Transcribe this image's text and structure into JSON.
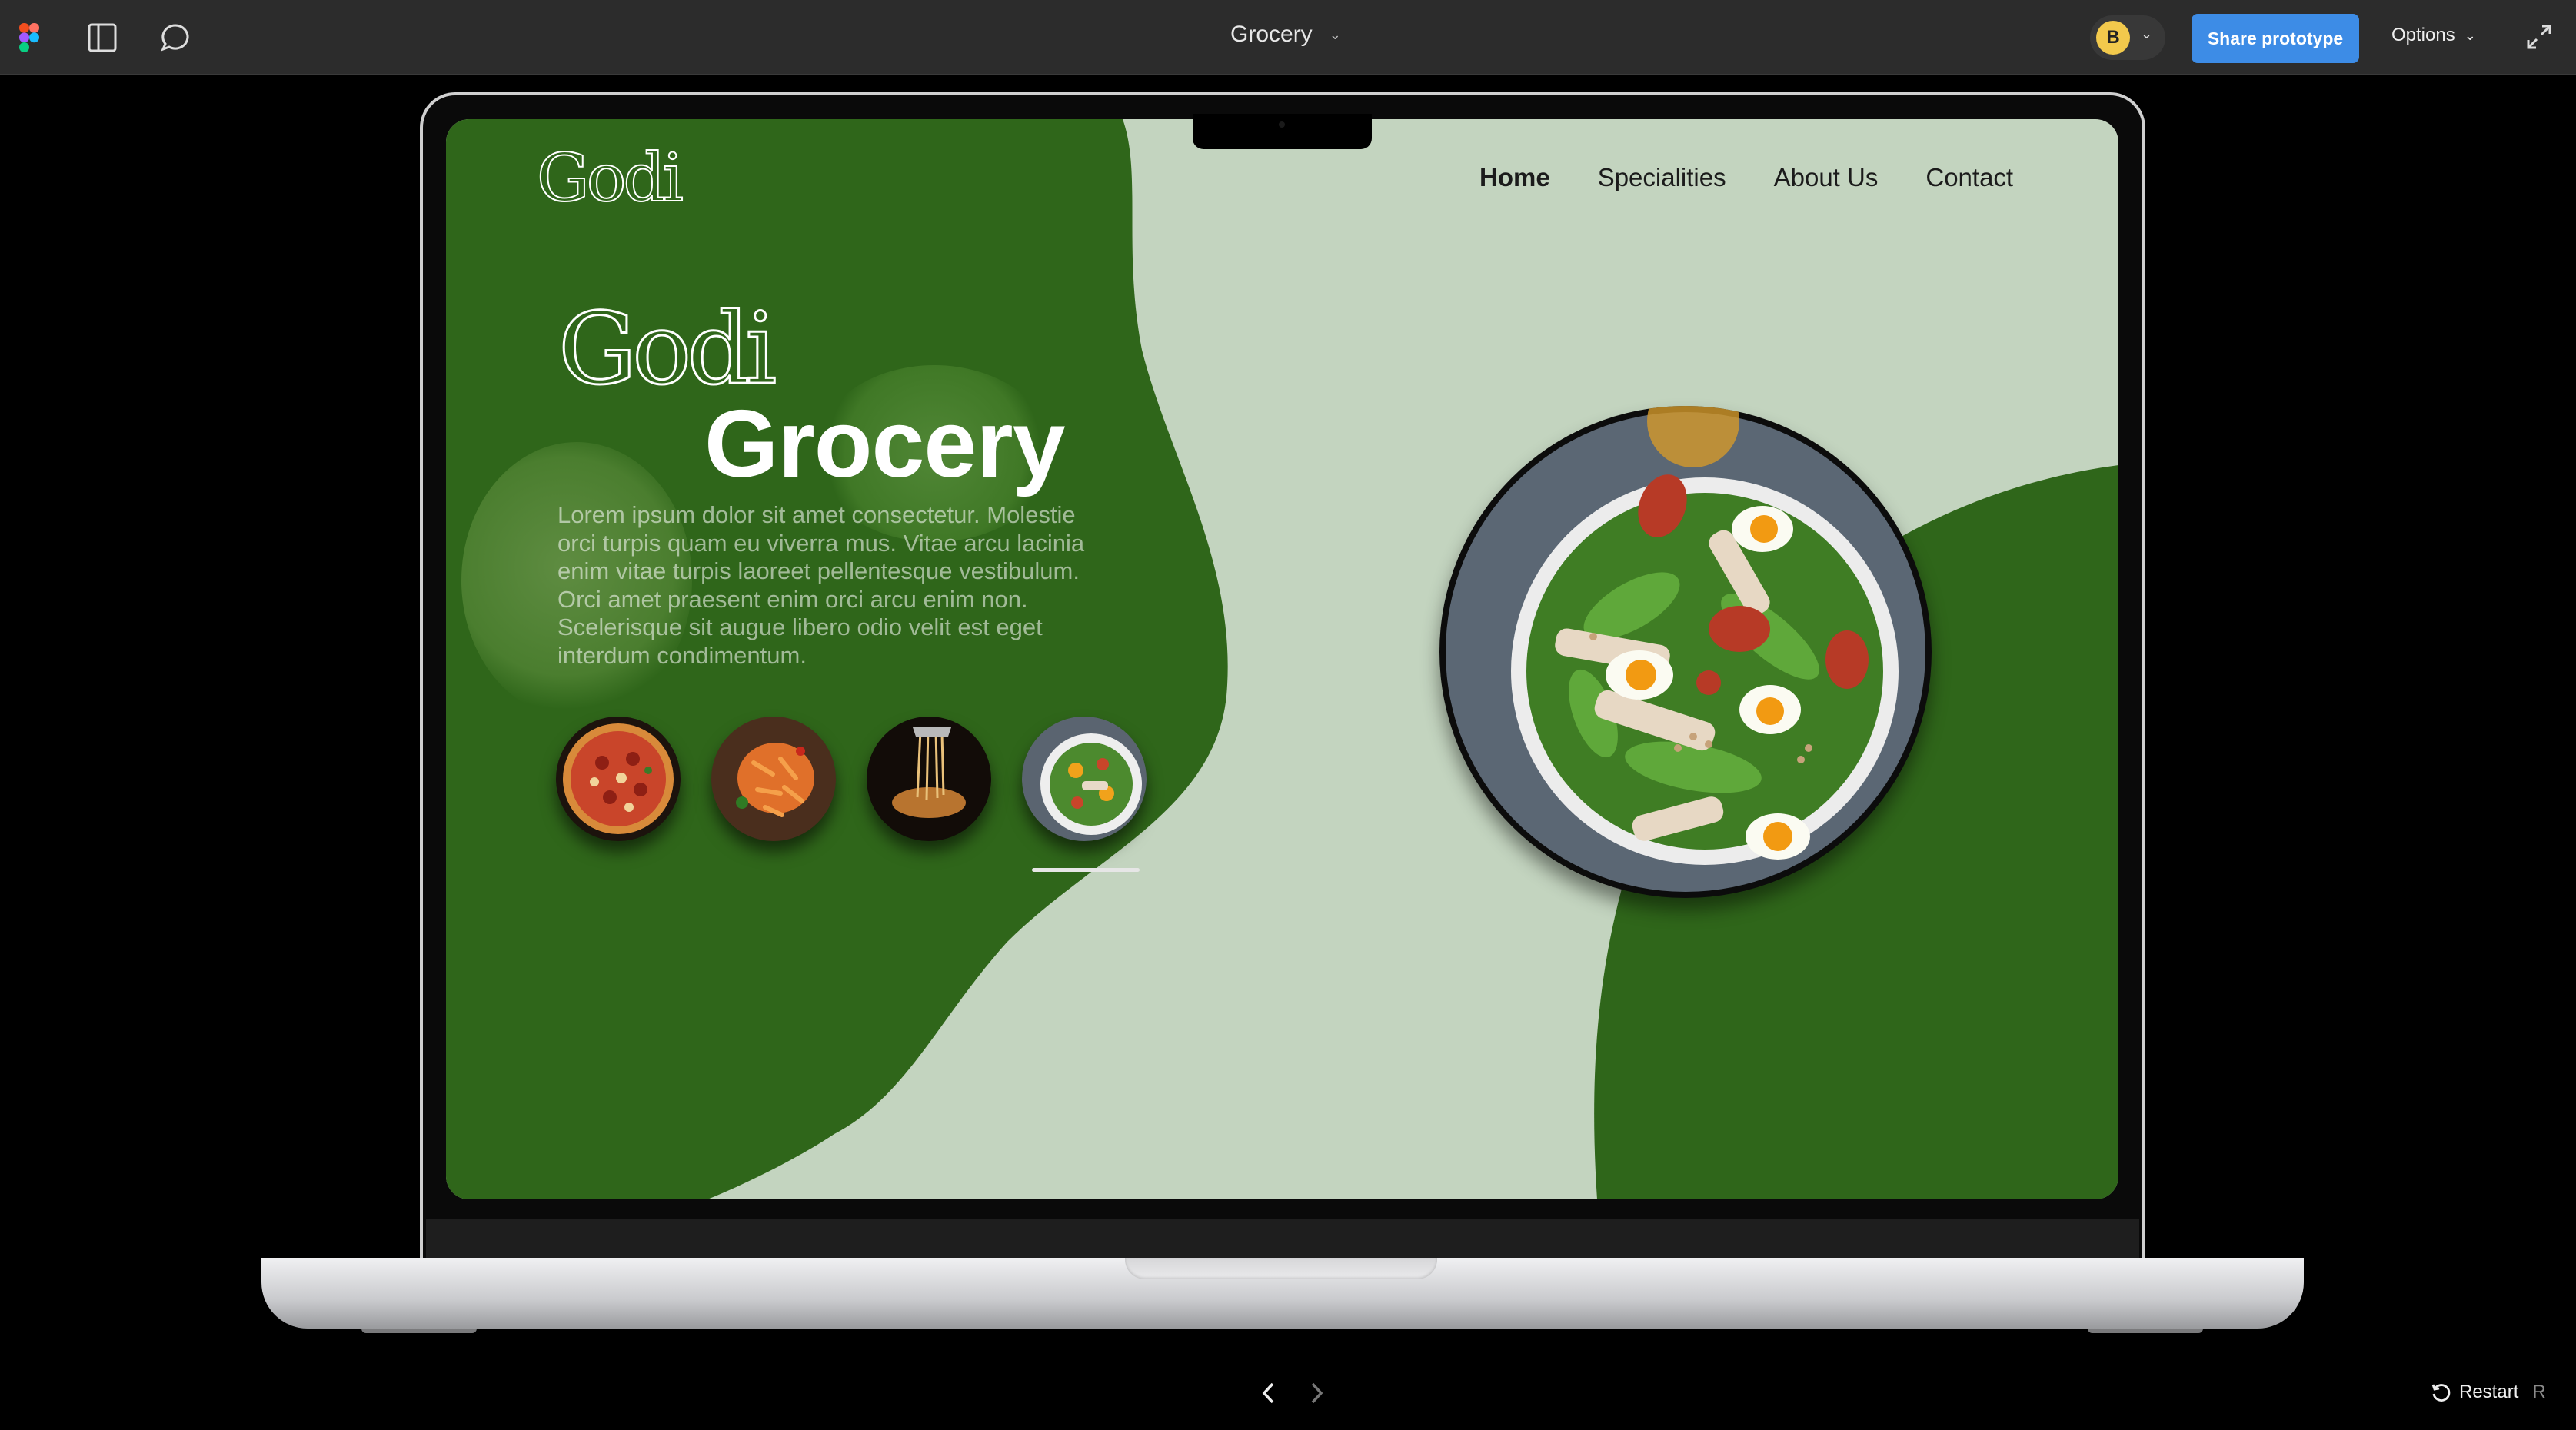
{
  "app": {
    "file_title": "Grocery",
    "avatar_initial": "B",
    "share_label": "Share prototype",
    "options_label": "Options",
    "restart_label": "Restart",
    "restart_shortcut": "R"
  },
  "site": {
    "logo_text": "Godi",
    "nav": [
      {
        "label": "Home",
        "active": true
      },
      {
        "label": "Specialities",
        "active": false
      },
      {
        "label": "About Us",
        "active": false
      },
      {
        "label": "Contact",
        "active": false
      }
    ],
    "hero": {
      "brand": "Godi",
      "title": "Grocery",
      "body": "Lorem ipsum dolor sit amet consectetur. Molestie orci turpis quam eu viverra mus. Vitae arcu lacinia enim vitae turpis laoreet pellentesque vestibulum. Orci amet praesent enim orci arcu enim non. Scelerisque sit augue libero odio velit est eget interdum condimentum."
    },
    "thumbnails": [
      "pizza",
      "penne pasta",
      "spaghetti",
      "salad"
    ],
    "selected_thumbnail": 4,
    "colors": {
      "dark_green": "#2f661a",
      "light_green": "#c3d4bf"
    }
  },
  "icons": [
    "figma-logo-icon",
    "sidebar-toggle-icon",
    "comment-icon",
    "chevron-down-icon",
    "expand-icon",
    "prev-arrow-icon",
    "next-arrow-icon",
    "restart-icon"
  ]
}
